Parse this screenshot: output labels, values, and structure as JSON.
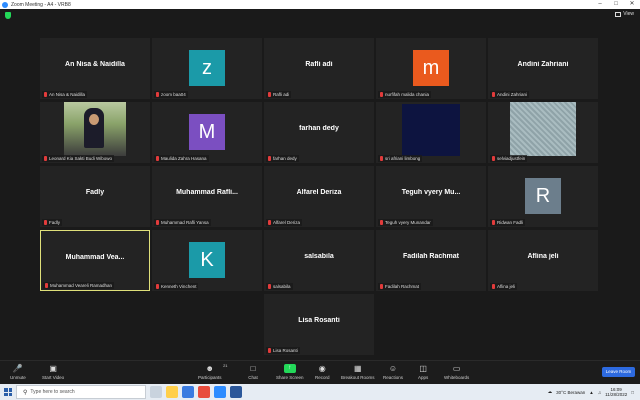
{
  "window": {
    "title": "Zoom Meeting - A4 - VRB8",
    "min_icon": "minimize-icon",
    "max_icon": "maximize-icon",
    "close_icon": "close-icon"
  },
  "header": {
    "view_label": "View",
    "security_icon": "shield-icon"
  },
  "participants_grid": [
    {
      "display": "An Nisa & Naidilla",
      "tag": "An Nisa & Naidilla",
      "kind": "name"
    },
    {
      "display": "z",
      "tag": "zoom baa04",
      "kind": "avatar",
      "color": "#1b9aa8"
    },
    {
      "display": "Rafli adi",
      "tag": "Rafli adi",
      "kind": "name"
    },
    {
      "display": "m",
      "tag": "nurfifah malida chania",
      "kind": "avatar",
      "color": "#ea5a1e"
    },
    {
      "display": "Andini Zahriani",
      "tag": "Andini Zahriani",
      "kind": "name"
    },
    {
      "display": "",
      "tag": "Leonard Kia Sakti Budi Wibowo",
      "kind": "video-graduate"
    },
    {
      "display": "M",
      "tag": "Maulida Zahra Hasana",
      "kind": "avatar",
      "color": "#7b4fc1"
    },
    {
      "display": "farhan dedy",
      "tag": "farhan dedy",
      "kind": "name"
    },
    {
      "display": "",
      "tag": "sri afriani limbong",
      "kind": "video-dark"
    },
    {
      "display": "",
      "tag": "selviadjustfein",
      "kind": "video-pattern"
    },
    {
      "display": "Fadly",
      "tag": "Fadly",
      "kind": "name"
    },
    {
      "display": "Muhammad  Rafli...",
      "tag": "Muhammad Rafli Yansa",
      "kind": "name"
    },
    {
      "display": "Alfarel Deriza",
      "tag": "Alfarel Deriza",
      "kind": "name"
    },
    {
      "display": "Teguh vyery Mu...",
      "tag": "Teguh vyery Munandar",
      "kind": "name"
    },
    {
      "display": "R",
      "tag": "Ridwan Fadli",
      "kind": "avatar",
      "color": "#6c7e8c"
    },
    {
      "display": "Muhammad  Vea...",
      "tag": "Muhammad Veareli Ramadhan",
      "kind": "name",
      "active": true
    },
    {
      "display": "K",
      "tag": "Kenneth Vinchent",
      "kind": "avatar",
      "color": "#1b9aa8"
    },
    {
      "display": "salsabila",
      "tag": "salsabila",
      "kind": "name"
    },
    {
      "display": "Fadilah Rachmat",
      "tag": "Fadilah Rachmat",
      "kind": "name"
    },
    {
      "display": "Aflina jeli",
      "tag": "Aflina jeli",
      "kind": "name"
    },
    {
      "display": "Lisa Rosanti",
      "tag": "Lisa Rosanti",
      "kind": "name"
    }
  ],
  "toolbar": {
    "unmute": "Unmute",
    "start_video": "Start Video",
    "participants": "Participants",
    "participants_count": "21",
    "chat": "Chat",
    "share_screen": "Share Screen",
    "record": "Record",
    "breakout": "Breakout Rooms",
    "reactions": "Reactions",
    "apps": "Apps",
    "whiteboards": "Whiteboards",
    "leave": "Leave Room"
  },
  "taskbar": {
    "search_placeholder": "Type here to search",
    "weather": "30°C  Berawan",
    "time": "16:09",
    "date": "11/28/2022"
  }
}
